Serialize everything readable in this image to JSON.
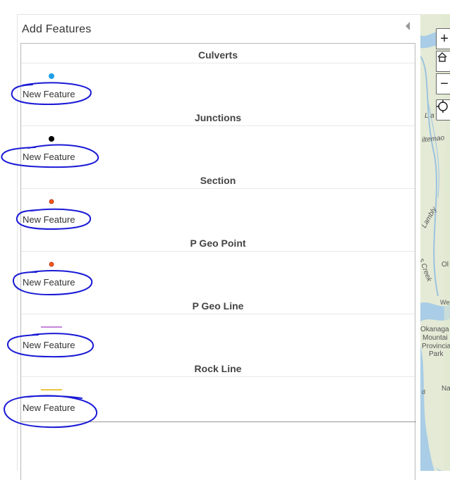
{
  "panel": {
    "title": "Add Features"
  },
  "layers": [
    {
      "name": "Culverts",
      "template_label": "New Feature",
      "symbol": "point",
      "color": "#1ea0e6"
    },
    {
      "name": "Junctions",
      "template_label": "New Feature",
      "symbol": "point",
      "color": "#000000"
    },
    {
      "name": "Section",
      "template_label": "New Feature",
      "symbol": "point",
      "color": "#ff5a1e"
    },
    {
      "name": "P Geo Point",
      "template_label": "New Feature",
      "symbol": "point",
      "color": "#ff5a1e"
    },
    {
      "name": "P Geo Line",
      "template_label": "New Feature",
      "symbol": "line",
      "color": "#b45ad2"
    },
    {
      "name": "Rock Line",
      "template_label": "New Feature",
      "symbol": "line",
      "color": "#e6b400"
    }
  ],
  "annotation": {
    "color": "#1a1ad6"
  },
  "map": {
    "zoom_in_label": "+",
    "zoom_out_label": "−",
    "labels": {
      "la": "L a",
      "itemao": "iltemao",
      "lambly": "Lambly",
      "creek": "s Creek",
      "ol": "Ol",
      "wes": "Wes",
      "okanagan": "Okanaga",
      "mountain": "Mountai",
      "provincial": "Provincia",
      "park": "Park",
      "na": "Na",
      "d": "d"
    }
  }
}
